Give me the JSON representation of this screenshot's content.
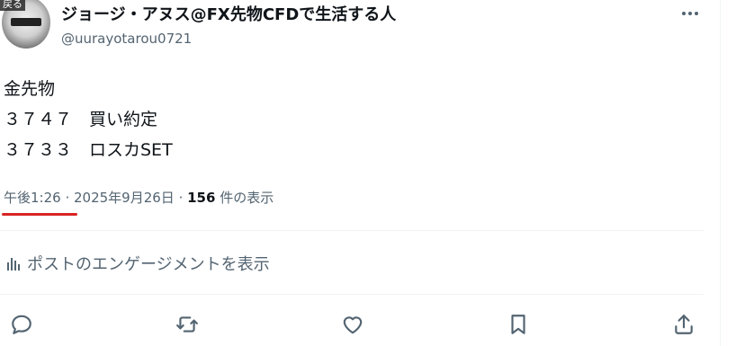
{
  "author": {
    "display_name": "ジョージ・アヌス@FX先物CFDで生活する人",
    "handle": "@uurayotarou0721",
    "avatar_overlay_label": "戻る"
  },
  "post": {
    "lines": [
      "金先物",
      "３７４７　買い約定",
      "３７３３　ロスカSET"
    ]
  },
  "meta": {
    "time": "午後1:26",
    "separator": " · ",
    "date": "2025年9月26日",
    "views_count": "156",
    "views_label": " 件の表示"
  },
  "engagements_label": "ポストのエンゲージメントを表示",
  "colors": {
    "underline": "#d92323",
    "secondary_text": "#536471",
    "primary_text": "#0f1419"
  },
  "icons": {
    "more": "more-dots-icon",
    "stats": "bar-chart-icon",
    "reply": "reply-icon",
    "repost": "repost-icon",
    "like": "heart-icon",
    "bookmark": "bookmark-icon",
    "share": "share-icon"
  }
}
